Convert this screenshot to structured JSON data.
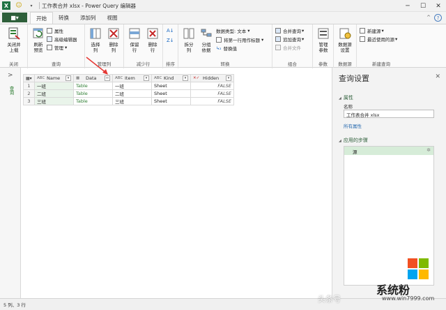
{
  "window": {
    "title": "工作表合并 xlsx - Power Query 编辑器",
    "quick_access_icon": "smiley-icon"
  },
  "tabs": {
    "file": "■▾",
    "items": [
      "开始",
      "转换",
      "添加列",
      "视图"
    ],
    "active": "开始"
  },
  "ribbon": {
    "groups": {
      "close": {
        "label": "关闭",
        "btn": "关闭并\n上载"
      },
      "query": {
        "label": "查询",
        "refresh": "刷新\n预览",
        "props": "属性",
        "adv": "高级编辑器",
        "manage": "管理"
      },
      "manage_cols": {
        "label": "管理列",
        "choose": "选择\n列",
        "remove": "删除\n列"
      },
      "reduce_rows": {
        "label": "减少行",
        "keep": "保留\n行",
        "remove": "删除\n行"
      },
      "sort": {
        "label": "排序"
      },
      "transform": {
        "label": "转换",
        "split": "拆分\n列",
        "group": "分组\n依据",
        "dtype": "数据类型: 文本",
        "first_row": "将第一行用作标题",
        "replace": "替换值"
      },
      "combine": {
        "label": "组合",
        "merge": "合并查询",
        "append": "追加查询",
        "combine_files": "合并文件"
      },
      "params": {
        "label": "参数",
        "manage": "管理\n参数"
      },
      "datasource": {
        "label": "数据源",
        "settings": "数据源\n设置"
      },
      "new_query": {
        "label": "新建查询",
        "new_source": "新建源",
        "recent": "最近使用的源"
      }
    }
  },
  "left_pane": {
    "label": "查询"
  },
  "grid": {
    "columns": [
      {
        "name": "Name",
        "type": "ABC"
      },
      {
        "name": "Data",
        "type": "▦"
      },
      {
        "name": "Item",
        "type": "ABC"
      },
      {
        "name": "Kind",
        "type": "ABC"
      },
      {
        "name": "Hidden",
        "type": "✕✓"
      }
    ],
    "rows": [
      {
        "num": "1",
        "name": "一班",
        "data": "Table",
        "item": "一班",
        "kind": "Sheet",
        "hidden": "FALSE"
      },
      {
        "num": "2",
        "name": "二班",
        "data": "Table",
        "item": "二班",
        "kind": "Sheet",
        "hidden": "FALSE"
      },
      {
        "num": "3",
        "name": "三班",
        "data": "Table",
        "item": "三班",
        "kind": "Sheet",
        "hidden": "FALSE"
      }
    ]
  },
  "settings": {
    "title": "查询设置",
    "props_section": "属性",
    "name_label": "名称",
    "name_value": "工作表合并 xlsx",
    "all_props": "所有属性",
    "steps_section": "应用的步骤",
    "steps": [
      "源"
    ]
  },
  "status": {
    "text": "5 列、3 行"
  },
  "watermark": {
    "text": "头条号",
    "brand": "系统粉",
    "url": "www.win7999.com"
  },
  "colors": {
    "accent_green": "#2e7d32",
    "annotation_red": "#e53935"
  }
}
